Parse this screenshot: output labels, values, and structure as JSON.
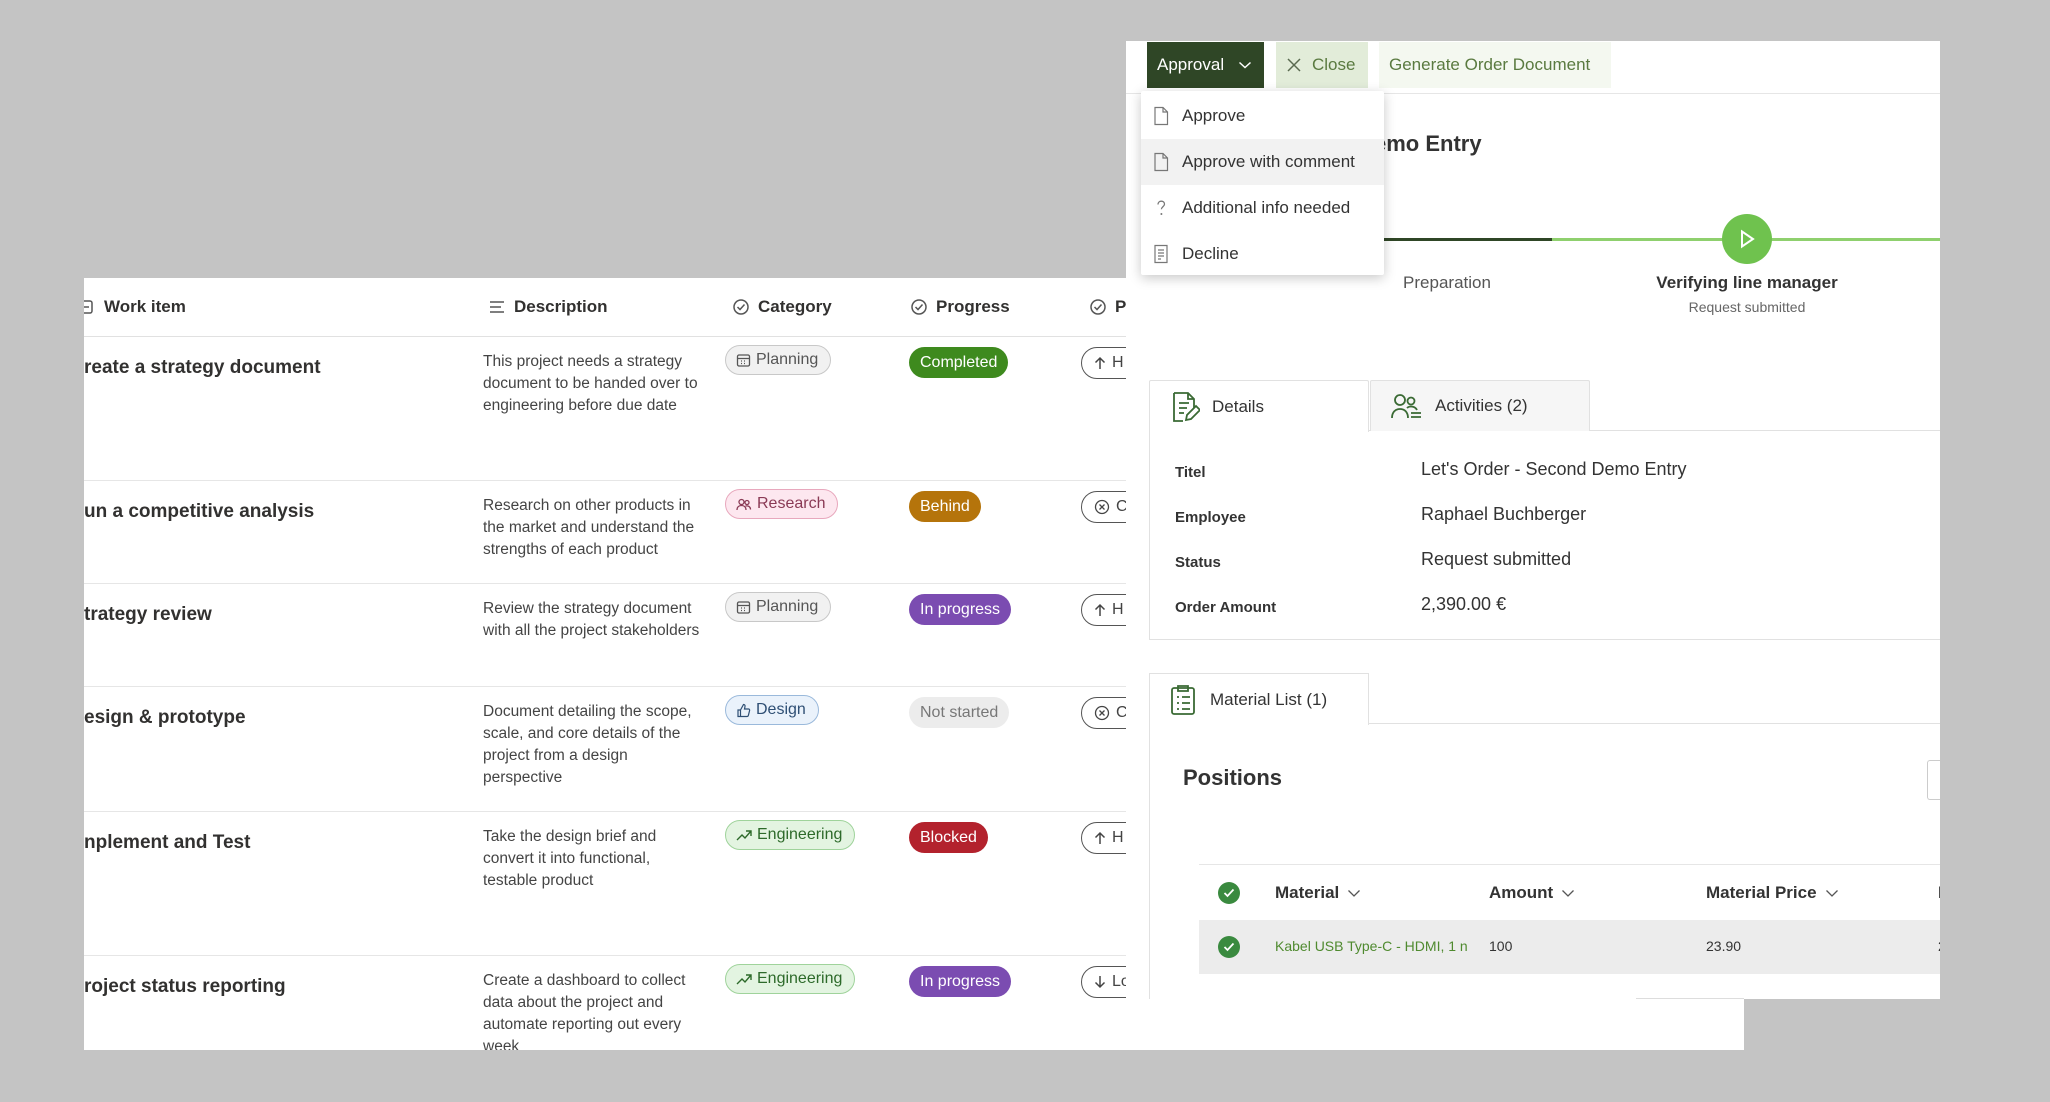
{
  "list": {
    "columns": {
      "work_item": "Work item",
      "description": "Description",
      "category": "Category",
      "progress": "Progress",
      "priority": "P"
    },
    "rows": [
      {
        "title": "reate a strategy document",
        "description": "This project needs a strategy document to be handed over to engineering before due date",
        "category": "Planning",
        "category_icon": "calendar-icon",
        "progress": "Completed",
        "priority": "H",
        "priority_icon": "arrow-up-icon"
      },
      {
        "title": "un a competitive analysis",
        "description": "Research on other products in the market and understand the strengths of each product",
        "category": "Research",
        "category_icon": "people-icon",
        "progress": "Behind",
        "priority": "C",
        "priority_icon": "x-circle-icon"
      },
      {
        "title": "trategy review",
        "description": "Review the strategy document with all the project stakeholders",
        "category": "Planning",
        "category_icon": "calendar-icon",
        "progress": "In progress",
        "priority": "H",
        "priority_icon": "arrow-up-icon"
      },
      {
        "title": "esign & prototype",
        "description": "Document detailing the scope, scale, and core details of the project from a design perspective",
        "category": "Design",
        "category_icon": "thumb-icon",
        "progress": "Not started",
        "priority": "C",
        "priority_icon": "x-circle-icon"
      },
      {
        "title": "nplement and Test",
        "description": "Take the design brief and convert it into functional, testable product",
        "category": "Engineering",
        "category_icon": "trend-icon",
        "progress": "Blocked",
        "priority": "H",
        "priority_icon": "arrow-up-icon"
      },
      {
        "title": "roject status reporting",
        "description": "Create a dashboard to collect data about the project and automate reporting out every week",
        "category": "Engineering",
        "category_icon": "trend-icon",
        "progress": "In progress",
        "priority": "Lo",
        "priority_icon": "arrow-down-icon"
      }
    ]
  },
  "form": {
    "toolbar": {
      "approval_label": "Approval",
      "close_label": "Close",
      "generate_label": "Generate Order Document"
    },
    "approval_menu": [
      {
        "label": "Approve",
        "icon": "document-icon"
      },
      {
        "label": "Approve with comment",
        "icon": "document-icon"
      },
      {
        "label": "Additional info needed",
        "icon": "question-icon"
      },
      {
        "label": "Decline",
        "icon": "document-list-icon"
      }
    ],
    "title_partial": "emo Entry",
    "stages": {
      "previous": "Preparation",
      "active": "Verifying line manager",
      "active_sub": "Request submitted"
    },
    "tabs": {
      "details": "Details",
      "activities": "Activities (2)"
    },
    "details": {
      "title_label": "Titel",
      "title_value": "Let's Order - Second Demo Entry",
      "employee_label": "Employee",
      "employee_value": "Raphael Buchberger",
      "status_label": "Status",
      "status_value": "Request submitted",
      "amount_label": "Order Amount",
      "amount_value": "2,390.00 €"
    },
    "material_tab": "Material List (1)",
    "positions_title": "Positions",
    "grid": {
      "columns": {
        "material": "Material",
        "amount": "Amount",
        "price": "Material Price",
        "extra": "L"
      },
      "rows": [
        {
          "material": "Kabel USB Type-C - HDMI, 1 n",
          "amount": "100",
          "price": "23.90",
          "extra": "2"
        }
      ]
    }
  },
  "colors": {
    "background": "#c4c4c4",
    "accent_dark_green": "#2f4626",
    "accent_light_green": "#6fc24e",
    "link_green": "#5a7a40"
  }
}
